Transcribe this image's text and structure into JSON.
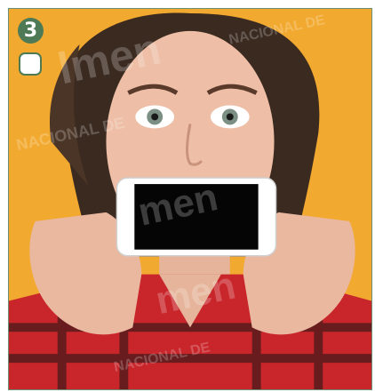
{
  "question": {
    "number": "3",
    "selected": false
  },
  "image": {
    "subject": "woman-holding-phone-over-mouth",
    "colors": {
      "background": "#f2a92f",
      "accent": "#4e7a56",
      "shirt": "#c9262b"
    }
  },
  "icons": {
    "checkbox": "checkbox-icon"
  }
}
